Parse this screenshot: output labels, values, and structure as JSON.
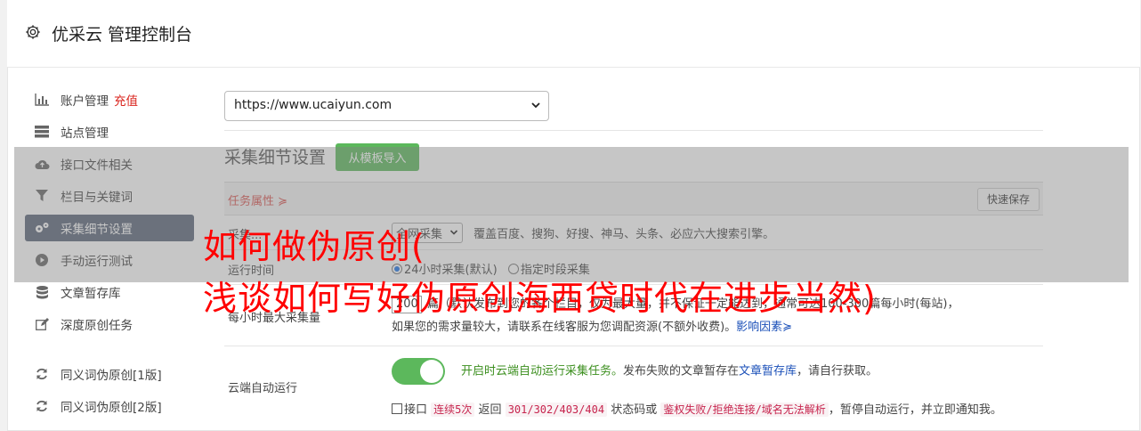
{
  "header": {
    "title": "优采云 管理控制台"
  },
  "sidebar": {
    "items": [
      {
        "label": "账户管理",
        "badge": "充值",
        "icon": "bar-chart-icon"
      },
      {
        "label": "站点管理",
        "icon": "server-icon"
      },
      {
        "label": "接口文件相关",
        "icon": "cloud-upload-icon"
      },
      {
        "label": "栏目与关键词",
        "icon": "filter-icon"
      },
      {
        "label": "采集细节设置",
        "icon": "gears-icon"
      },
      {
        "label": "手动运行测试",
        "icon": "play-circle-icon"
      },
      {
        "label": "文章暂存库",
        "icon": "database-icon"
      },
      {
        "label": "深度原创任务",
        "icon": "edit-icon"
      },
      {
        "label": "同义词伪原创[1版]",
        "icon": "refresh-icon"
      },
      {
        "label": "同义词伪原创[2版]",
        "icon": "refresh-icon"
      }
    ]
  },
  "site_select": {
    "value": "https://www.ucaiyun.com"
  },
  "section": {
    "title": "采集细节设置",
    "template_button": "从模板导入"
  },
  "table": {
    "tab_label": "任务属性 ≽",
    "save_button": "快速保存",
    "row1": {
      "label": "采集...",
      "select_value": "全网采集",
      "desc": "覆盖百度、搜狗、好搜、神马、头条、必应六大搜索引擎。"
    },
    "row2": {
      "label": "运行时间",
      "opt1": "24小时采集(默认)",
      "opt2": "指定时段采集"
    },
    "row3": {
      "label": "每小时最大采集量",
      "value": "200",
      "line1": "篇（默认发布到您的各个栏目，仅为最大量，并不保证一定能达到，通常可达100-300篇每小时(每站)，",
      "line2": "如果您的需求量较大，请联系在线客服为您调配资源(不额外收费)。",
      "link": "影响因素≽"
    },
    "row4": {
      "label": "云端自动运行",
      "green": "开启时云端自动运行采集任务。",
      "desc1": "发布失败的文章暂存在",
      "link": "文章暂存库",
      "desc2": "，请自行获取。",
      "cb_label": "接口",
      "code1": "连续5次",
      "t1": "返回",
      "code2": "301/302/403/404",
      "t2": "状态码或",
      "code3": "鉴权失败/拒绝连接/域名无法解析",
      "t3": "，暂停自动运行，并立即通知我。"
    }
  },
  "overlay": {
    "line1": "如何做伪原创(",
    "line2": "浅谈如何写好伪原创海西贷时代在进步当然)"
  },
  "colors": {
    "active_nav": "#5a6478",
    "green": "#5cb85c",
    "red_text": "#ff0000"
  }
}
